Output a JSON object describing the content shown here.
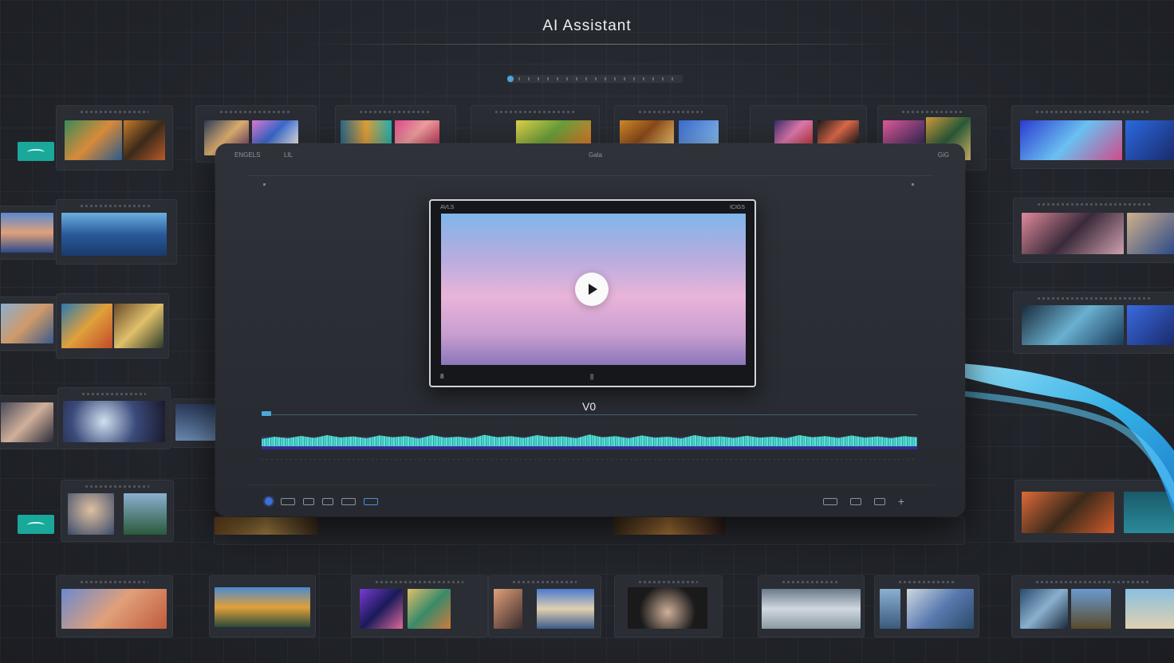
{
  "app": {
    "title": "AI Assistant"
  },
  "window": {
    "header_left": "ENGELS",
    "header_left_2": "LIL",
    "header_center": "Gala",
    "header_right": "GiG"
  },
  "preview": {
    "top_left": "AVLS",
    "top_right": "ICIGS",
    "bottom_left": "8",
    "pause_glyph": "||"
  },
  "timeline": {
    "track_label": "V0"
  },
  "toolbar": {
    "right_plus": "+"
  },
  "colors": {
    "accent_teal": "#1aa89a",
    "waveform": "#4fd1c8",
    "playhead": "#4aa9d8",
    "record_dot": "#3f6fd8"
  }
}
